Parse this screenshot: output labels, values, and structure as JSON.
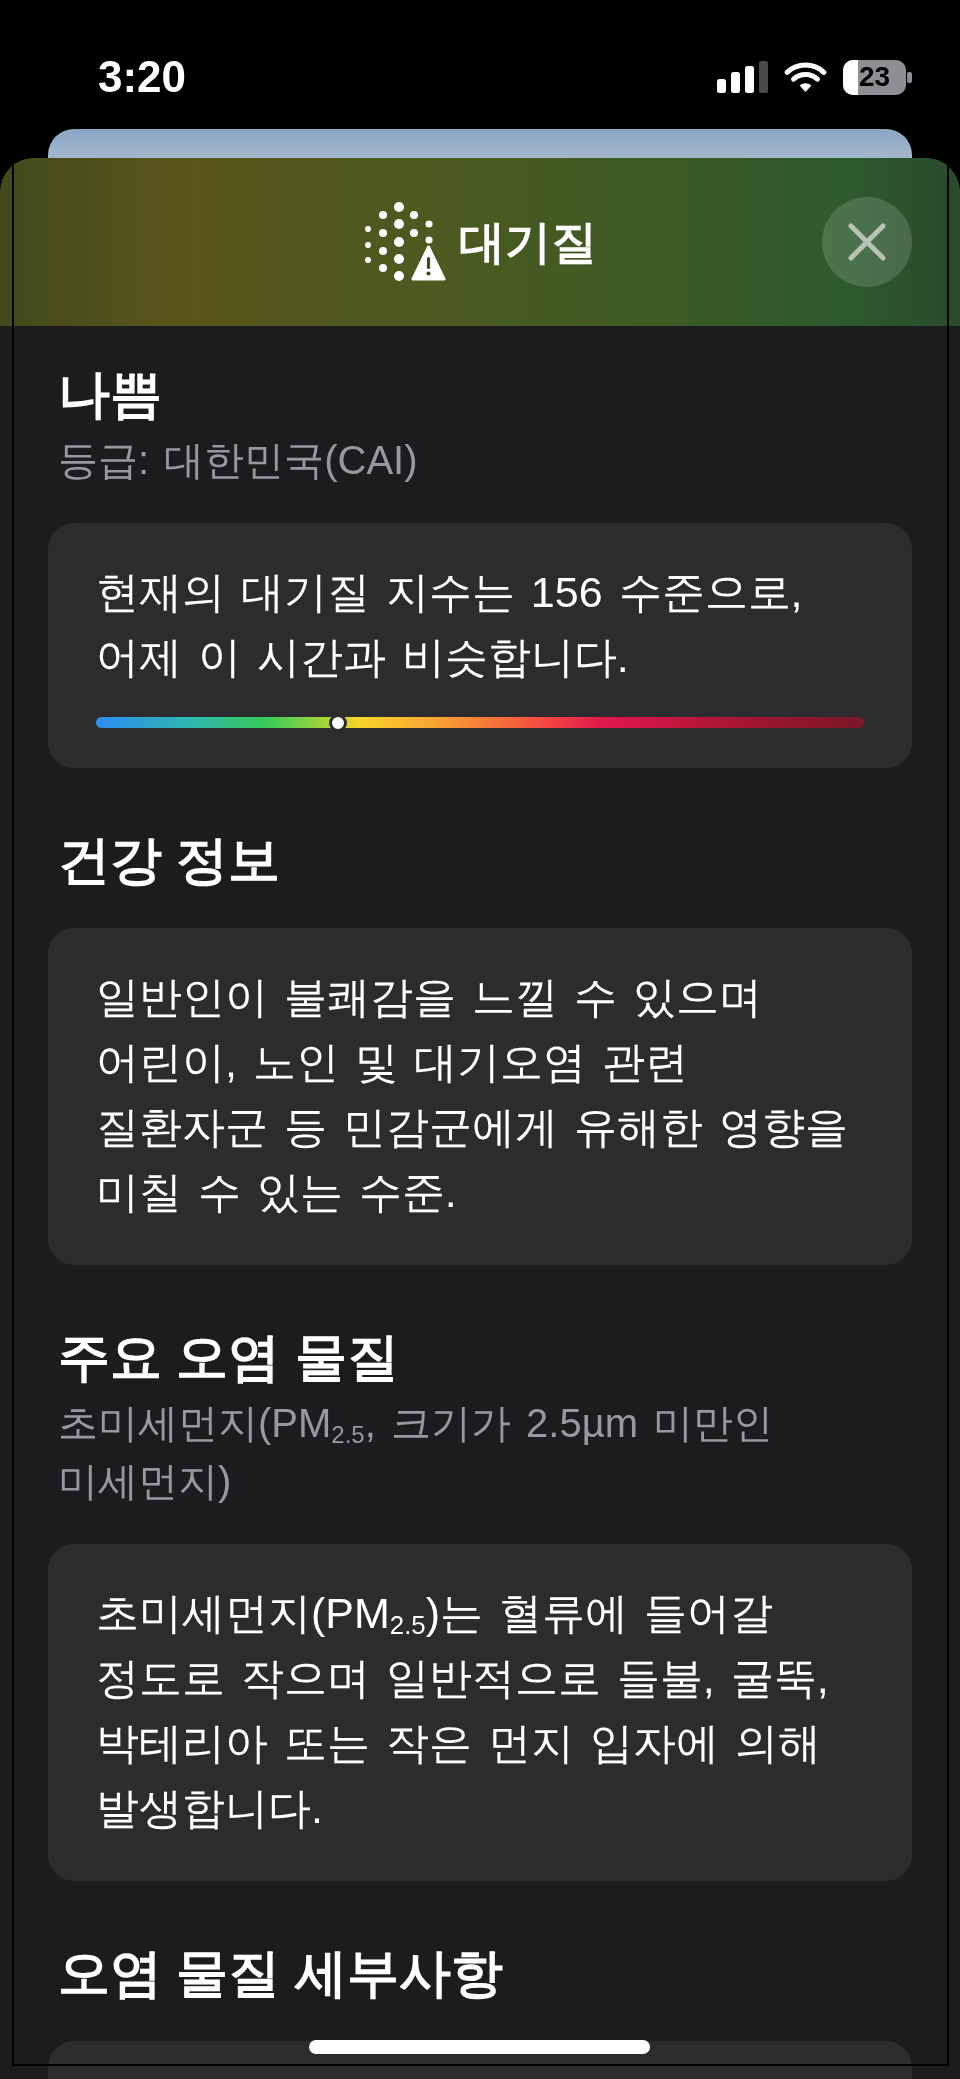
{
  "status_bar": {
    "time": "3:20",
    "battery": "23"
  },
  "sheet": {
    "title": "대기질"
  },
  "sections": [
    {
      "heading": "나쁨",
      "subtitle": "등급: 대한민국(CAI)",
      "text": "현재의 대기질 지수는 156 수준으로, 어제 이 시간과 비슷합니다.",
      "level": 0.315
    },
    {
      "heading": "건강 정보",
      "text": "일반인이 불쾌감을 느낄 수 있으며 어린이, 노인 및 대기오염 관련 질환자군 등 민감군에게 유해한 영향을 미칠 수 있는 수준."
    },
    {
      "heading": "주요 오염 물질",
      "subtitle": "초미세먼지(PM$_{2.5}$, 크기가 2.5µm 미만인 미세먼지)",
      "text": "초미세먼지(PM$_{2.5}$)는 혈류에 들어갈 정도로 작으며 일반적으로 들불, 굴뚝, 박테리아 또는 작은 먼지 입자에 의해 발생합니다."
    },
    {
      "heading": "오염 물질 세부사항"
    }
  ]
}
